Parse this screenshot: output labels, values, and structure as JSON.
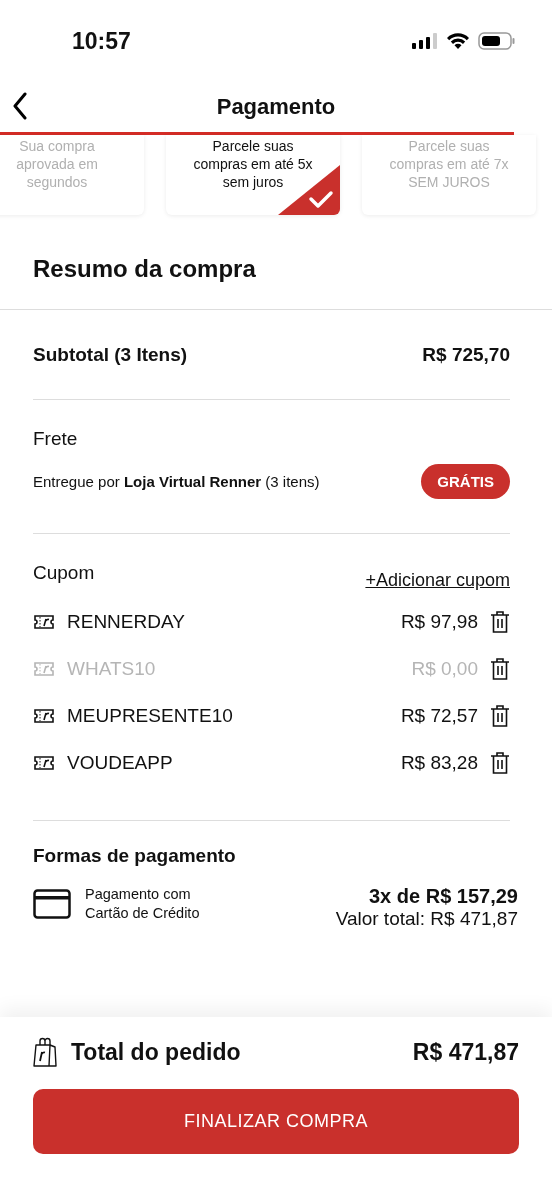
{
  "status_bar": {
    "time": "10:57"
  },
  "header": {
    "title": "Pagamento"
  },
  "offers": [
    {
      "text": "Sua compra aprovada em segundos",
      "selected": false
    },
    {
      "text": "Parcele suas compras em até 5x sem juros",
      "selected": true
    },
    {
      "text": "Parcele suas compras em até 7x SEM JUROS",
      "selected": false
    }
  ],
  "summary": {
    "title": "Resumo da compra",
    "subtotal": {
      "label": "Subtotal (3 Itens)",
      "value": "R$ 725,70"
    },
    "shipping": {
      "label": "Frete",
      "delivery": "Entregue por **Loja Virtual Renner** (3 itens)",
      "badge": "GRÁTIS"
    },
    "coupons": {
      "label": "Cupom",
      "add_link": "+Adicionar cupom",
      "items": [
        {
          "code": "RENNERDAY",
          "value": "R$ 97,98",
          "disabled": false
        },
        {
          "code": "WHATS10",
          "value": "R$ 0,00",
          "disabled": true
        },
        {
          "code": "MEUPRESENTE10",
          "value": "R$ 72,57",
          "disabled": false
        },
        {
          "code": "VOUDEAPP",
          "value": "R$ 83,28",
          "disabled": false
        }
      ]
    },
    "payment": {
      "title": "Formas de pagamento",
      "method": "Pagamento com Cartão de Crédito",
      "installments": "3x de R$ 157,29",
      "total": "Valor total: R$ 471,87"
    }
  },
  "footer": {
    "label": "Total do pedido",
    "value": "R$ 471,87",
    "button": "FINALIZAR COMPRA"
  }
}
